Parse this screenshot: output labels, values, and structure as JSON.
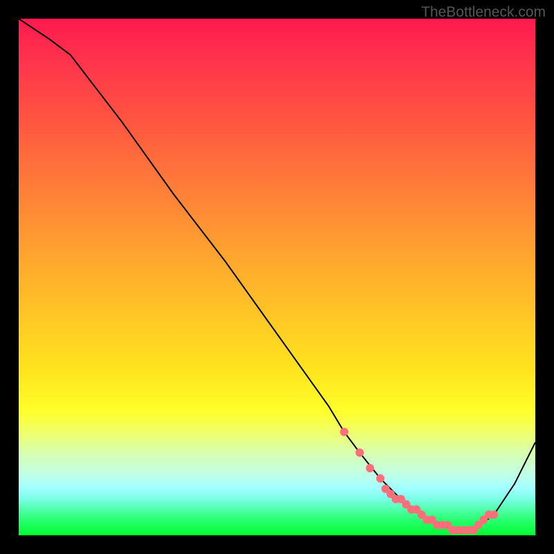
{
  "attribution": "TheBottleneck.com",
  "chart_data": {
    "type": "line",
    "title": "",
    "xlabel": "",
    "ylabel": "",
    "xlim": [
      0,
      100
    ],
    "ylim": [
      0,
      100
    ],
    "curve": {
      "x": [
        0,
        6,
        10,
        20,
        30,
        40,
        50,
        55,
        60,
        63,
        66,
        70,
        74,
        78,
        82,
        85,
        88,
        92,
        96,
        100
      ],
      "y": [
        100,
        96,
        93,
        80,
        66,
        53,
        39,
        32,
        25,
        20,
        16,
        11,
        7,
        4,
        2,
        1,
        1,
        4,
        10,
        18
      ]
    },
    "markers": {
      "x": [
        63,
        66,
        68,
        70,
        71,
        72,
        73,
        74,
        75,
        76,
        77,
        78,
        79,
        80,
        81,
        82,
        83,
        84,
        85,
        86,
        87,
        88,
        89,
        90,
        91,
        92
      ],
      "y": [
        20,
        16,
        13,
        11,
        9,
        8,
        7,
        7,
        6,
        5,
        5,
        4,
        3,
        3,
        2,
        2,
        2,
        1,
        1,
        1,
        1,
        1,
        2,
        3,
        4,
        4
      ],
      "color": "#ff6f7a",
      "radius": 6
    }
  }
}
